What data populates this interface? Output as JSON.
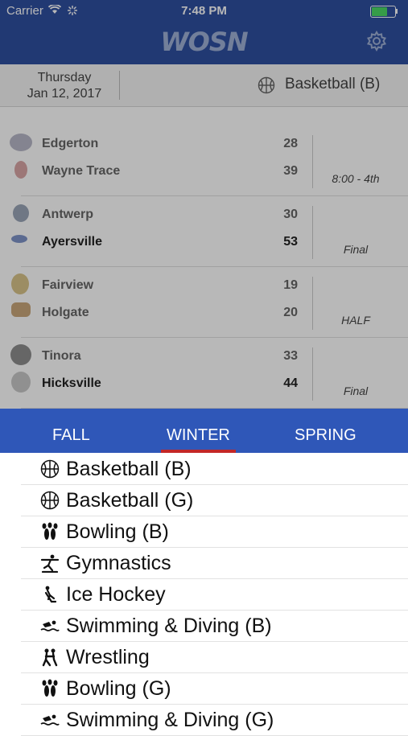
{
  "status_bar": {
    "carrier": "Carrier",
    "time": "7:48 PM"
  },
  "app": {
    "logo": "WOSN"
  },
  "filter": {
    "day": "Thursday",
    "date": "Jan 12, 2017",
    "sport": "Basketball (B)"
  },
  "games": [
    {
      "home": {
        "name": "Edgerton",
        "score": "28",
        "winner": false
      },
      "away": {
        "name": "Wayne Trace",
        "score": "39",
        "winner": false
      },
      "status": "8:00 - 4th"
    },
    {
      "home": {
        "name": "Antwerp",
        "score": "30",
        "winner": false
      },
      "away": {
        "name": "Ayersville",
        "score": "53",
        "winner": true
      },
      "status": "Final"
    },
    {
      "home": {
        "name": "Fairview",
        "score": "19",
        "winner": false
      },
      "away": {
        "name": "Holgate",
        "score": "20",
        "winner": false
      },
      "status": "HALF"
    },
    {
      "home": {
        "name": "Tinora",
        "score": "33",
        "winner": false
      },
      "away": {
        "name": "Hicksville",
        "score": "44",
        "winner": true
      },
      "status": "Final"
    }
  ],
  "season_tabs": {
    "fall": "FALL",
    "winter": "WINTER",
    "spring": "SPRING",
    "selected": "WINTER"
  },
  "sports": [
    {
      "label": "Basketball (B)",
      "icon": "basketball-icon"
    },
    {
      "label": "Basketball (G)",
      "icon": "basketball-icon"
    },
    {
      "label": "Bowling (B)",
      "icon": "bowling-icon"
    },
    {
      "label": "Gymnastics",
      "icon": "gymnastics-icon"
    },
    {
      "label": "Ice Hockey",
      "icon": "ice-hockey-icon"
    },
    {
      "label": "Swimming & Diving (B)",
      "icon": "swimming-icon"
    },
    {
      "label": "Wrestling",
      "icon": "wrestling-icon"
    },
    {
      "label": "Bowling (G)",
      "icon": "bowling-icon"
    },
    {
      "label": "Swimming & Diving (G)",
      "icon": "swimming-icon"
    }
  ],
  "colors": {
    "nav": "#2f4fa0",
    "tabs": "#2f57b8",
    "tab_indicator": "#c32727",
    "battery": "#4cd964"
  }
}
